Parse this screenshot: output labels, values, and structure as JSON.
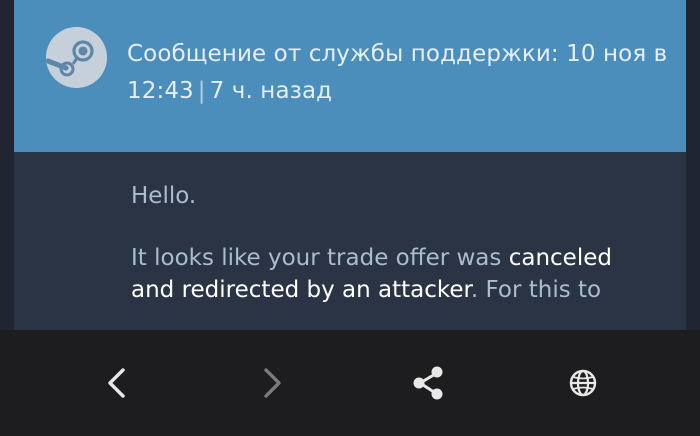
{
  "header": {
    "title_line1": "Сообщение от службы поддержки: 10 ноя в",
    "time": "12:43",
    "separator": "|",
    "relative_time": "7 ч. назад"
  },
  "message": {
    "greeting": "Hello.",
    "p2_intro": "It looks like your trade offer was ",
    "p2_highlight": "canceled and redirected by an attacker",
    "p2_after": ". For this to"
  },
  "nav": {
    "back": "back-icon",
    "forward": "forward-icon",
    "share": "share-icon",
    "globe": "globe-icon"
  },
  "colors": {
    "header_bg": "#4b8dbb",
    "body_bg": "#2a3444",
    "nav_bg": "#1d1d1f",
    "text_muted": "#a9bdd0",
    "text_highlight": "#ffffff"
  }
}
